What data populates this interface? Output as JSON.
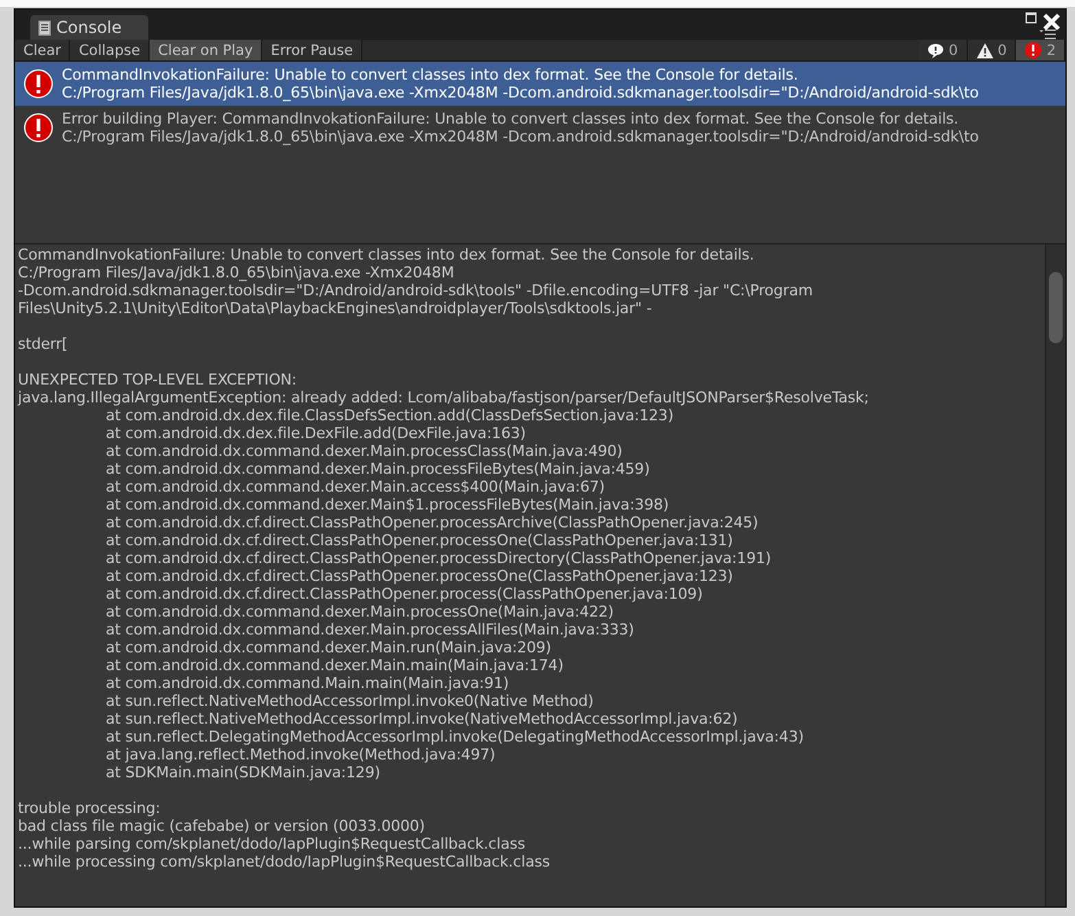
{
  "window": {
    "tab": "Console"
  },
  "toolbar": {
    "buttons": [
      {
        "label": "Clear",
        "on": false
      },
      {
        "label": "Collapse",
        "on": false
      },
      {
        "label": "Clear on Play",
        "on": true
      },
      {
        "label": "Error Pause",
        "on": false
      }
    ],
    "counters": [
      {
        "kind": "info",
        "count": "0",
        "on": false
      },
      {
        "kind": "warning",
        "count": "0",
        "on": false
      },
      {
        "kind": "error",
        "count": "2",
        "on": true
      }
    ]
  },
  "log": [
    {
      "kind": "error",
      "selected": true,
      "lines": [
        "CommandInvokationFailure: Unable to convert classes into dex format. See the Console for details.",
        "C:/Program Files/Java/jdk1.8.0_65\\bin\\java.exe -Xmx2048M -Dcom.android.sdkmanager.toolsdir=\"D:/Android/android-sdk\\to"
      ]
    },
    {
      "kind": "error",
      "selected": false,
      "lines": [
        "Error building Player: CommandInvokationFailure: Unable to convert classes into dex format. See the Console for details.",
        "C:/Program Files/Java/jdk1.8.0_65\\bin\\java.exe -Xmx2048M -Dcom.android.sdkmanager.toolsdir=\"D:/Android/android-sdk\\to"
      ]
    }
  ],
  "detail": {
    "blocks": [
      {
        "kind": "paragraph",
        "lines": [
          "CommandInvokationFailure: Unable to convert classes into dex format. See the Console for details.",
          "C:/Program Files/Java/jdk1.8.0_65\\bin\\java.exe -Xmx2048M",
          "-Dcom.android.sdkmanager.toolsdir=\"D:/Android/android-sdk\\tools\" -Dfile.encoding=UTF8 -jar \"C:\\Program",
          "Files\\Unity5.2.1\\Unity\\Editor\\Data\\PlaybackEngines\\androidplayer/Tools\\sdktools.jar\" -"
        ]
      },
      {
        "kind": "paragraph",
        "lines": [
          "stderr["
        ]
      },
      {
        "kind": "paragraph",
        "lines": [
          "UNEXPECTED TOP-LEVEL EXCEPTION:",
          "java.lang.IllegalArgumentException: already added: Lcom/alibaba/fastjson/parser/DefaultJSONParser$ResolveTask;"
        ]
      },
      {
        "kind": "stack",
        "lines": [
          "at com.android.dx.dex.file.ClassDefsSection.add(ClassDefsSection.java:123)",
          "at com.android.dx.dex.file.DexFile.add(DexFile.java:163)",
          "at com.android.dx.command.dexer.Main.processClass(Main.java:490)",
          "at com.android.dx.command.dexer.Main.processFileBytes(Main.java:459)",
          "at com.android.dx.command.dexer.Main.access$400(Main.java:67)",
          "at com.android.dx.command.dexer.Main$1.processFileBytes(Main.java:398)",
          "at com.android.dx.cf.direct.ClassPathOpener.processArchive(ClassPathOpener.java:245)",
          "at com.android.dx.cf.direct.ClassPathOpener.processOne(ClassPathOpener.java:131)",
          "at com.android.dx.cf.direct.ClassPathOpener.processDirectory(ClassPathOpener.java:191)",
          "at com.android.dx.cf.direct.ClassPathOpener.processOne(ClassPathOpener.java:123)",
          "at com.android.dx.cf.direct.ClassPathOpener.process(ClassPathOpener.java:109)",
          "at com.android.dx.command.dexer.Main.processOne(Main.java:422)",
          "at com.android.dx.command.dexer.Main.processAllFiles(Main.java:333)",
          "at com.android.dx.command.dexer.Main.run(Main.java:209)",
          "at com.android.dx.command.dexer.Main.main(Main.java:174)",
          "at com.android.dx.command.Main.main(Main.java:91)",
          "at sun.reflect.NativeMethodAccessorImpl.invoke0(Native Method)",
          "at sun.reflect.NativeMethodAccessorImpl.invoke(NativeMethodAccessorImpl.java:62)",
          "at sun.reflect.DelegatingMethodAccessorImpl.invoke(DelegatingMethodAccessorImpl.java:43)",
          "at java.lang.reflect.Method.invoke(Method.java:497)",
          "at SDKMain.main(SDKMain.java:129)"
        ]
      },
      {
        "kind": "paragraph",
        "lines": [
          "trouble processing:",
          "bad class file magic (cafebabe) or version (0033.0000)",
          "...while parsing com/skplanet/dodo/IapPlugin$RequestCallback.class",
          "...while processing com/skplanet/dodo/IapPlugin$RequestCallback.class"
        ]
      }
    ]
  }
}
